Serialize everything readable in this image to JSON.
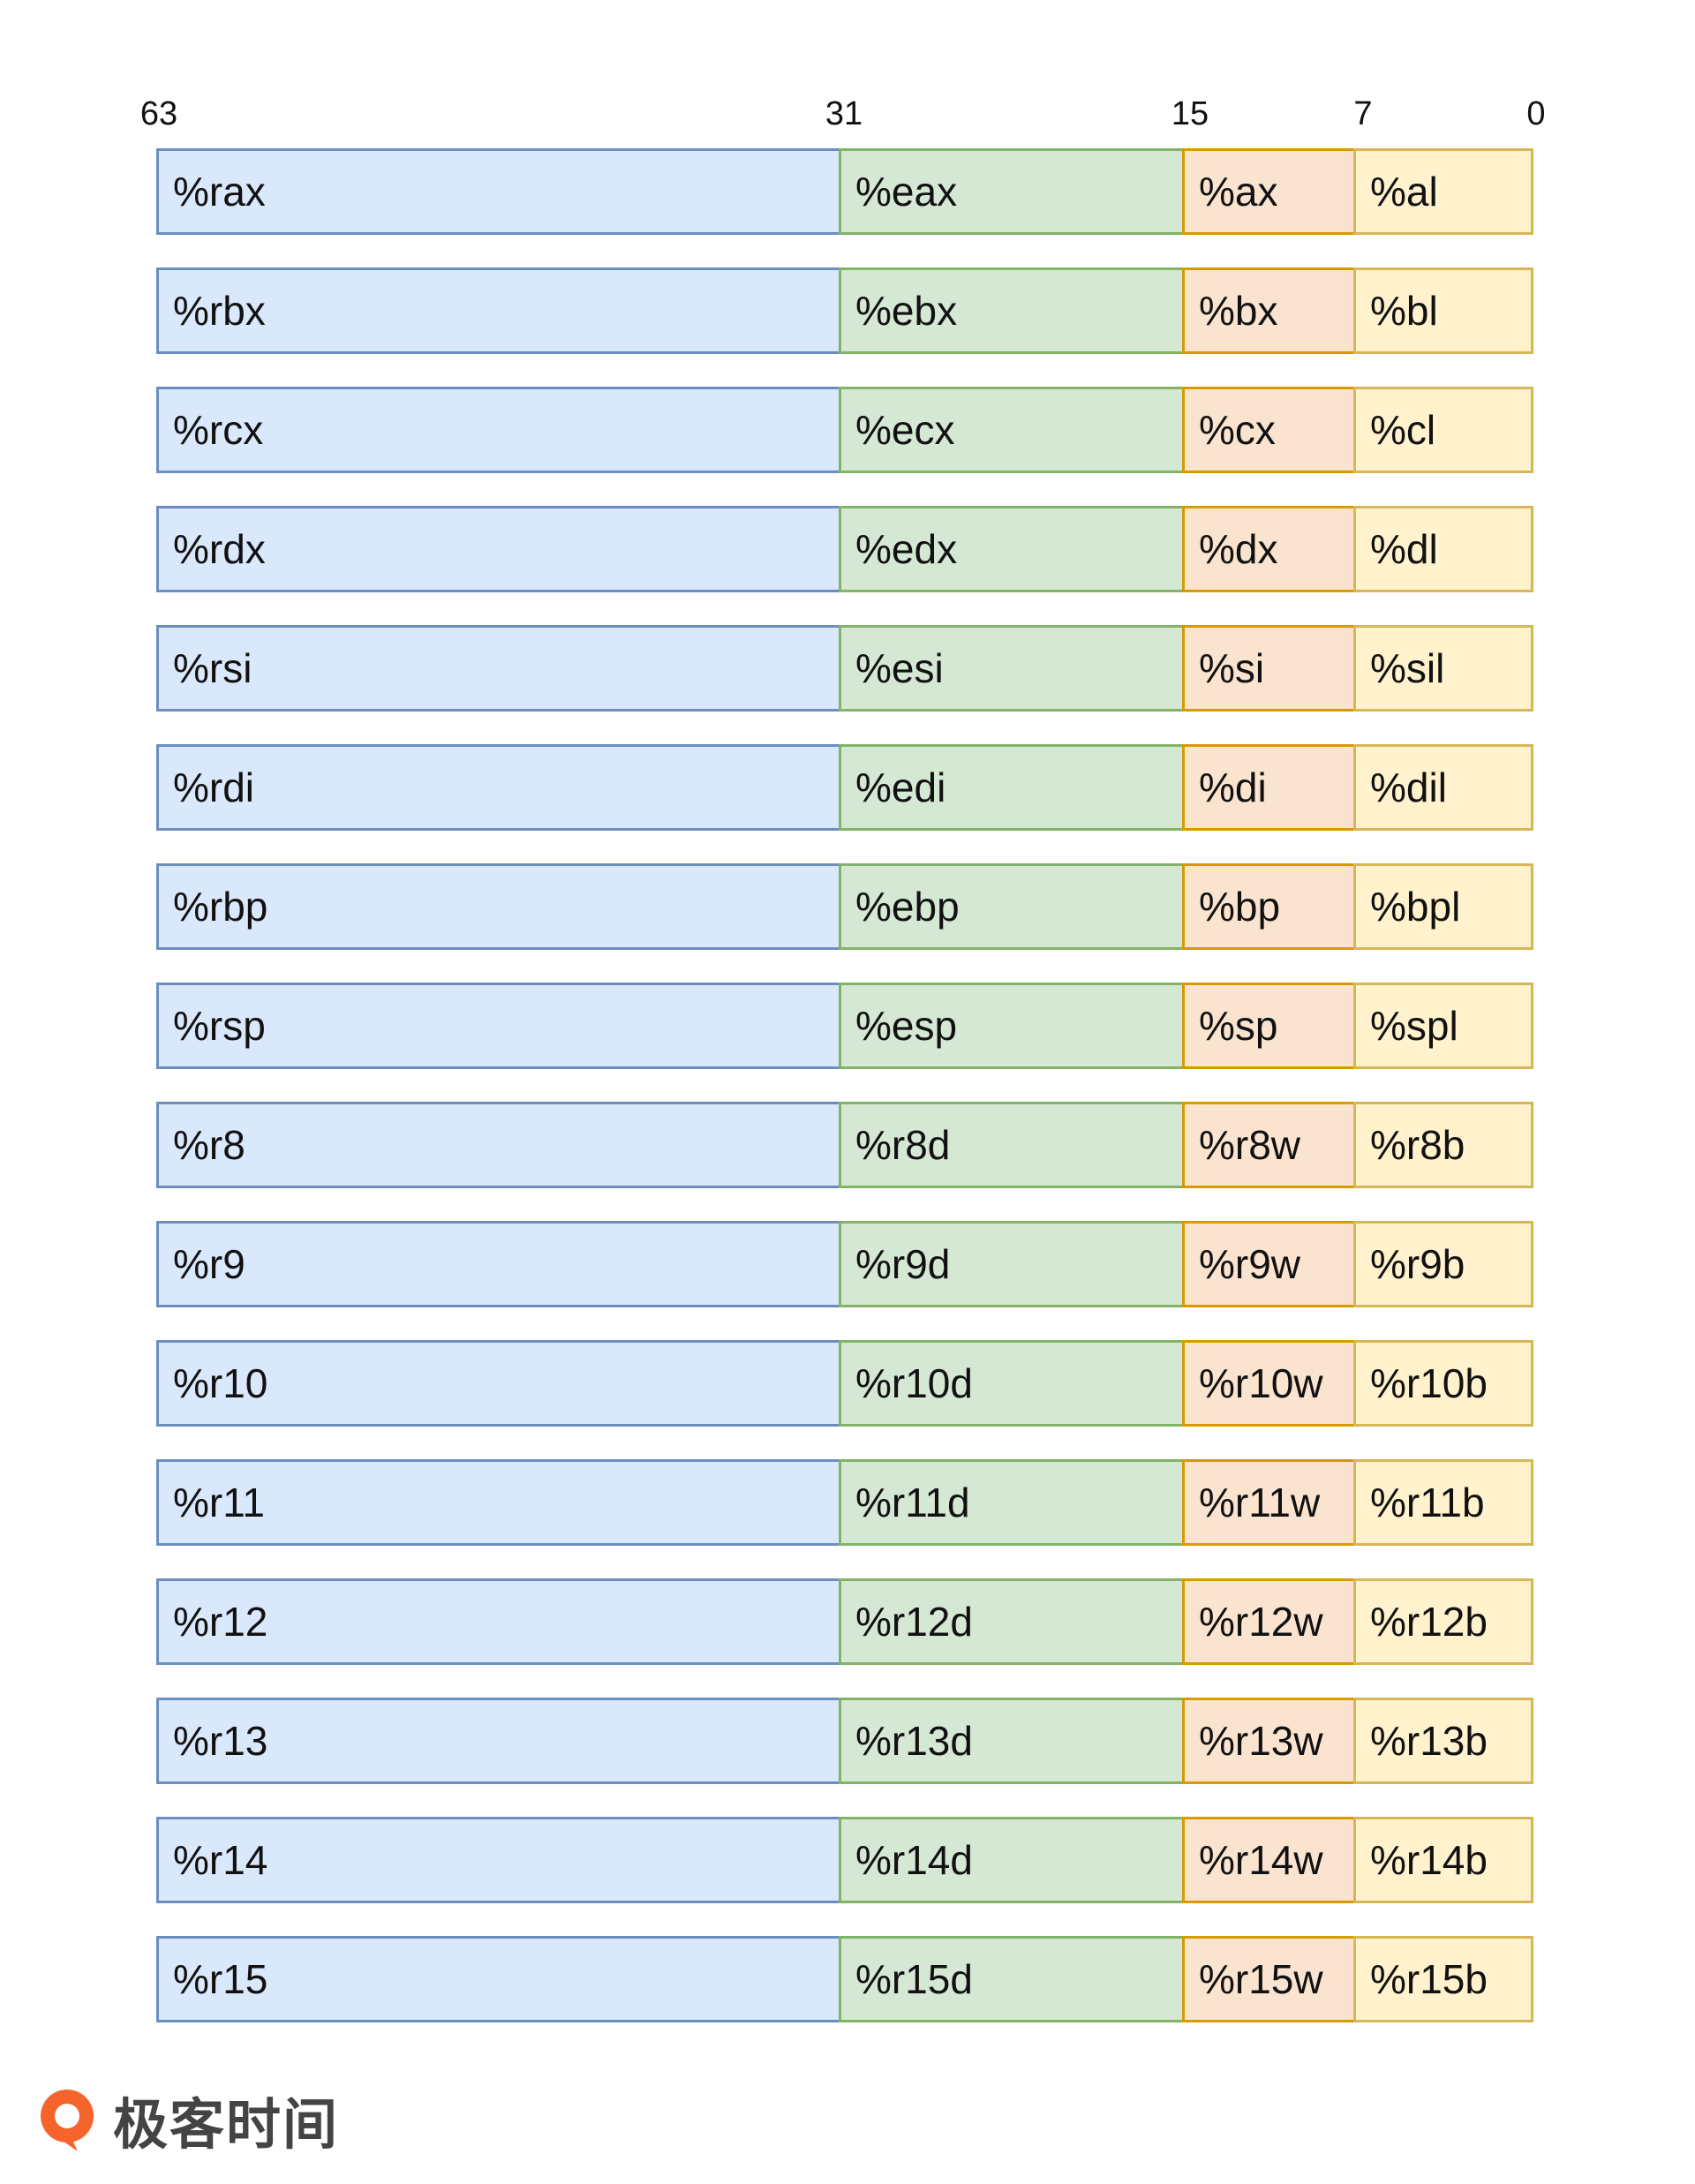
{
  "bit_labels": [
    "63",
    "31",
    "15",
    "7",
    "0"
  ],
  "colors": {
    "r64": "#dae8fc",
    "r32": "#d5e8d4",
    "r16": "#fae4cf",
    "r8": "#fff2cc"
  },
  "registers": [
    [
      "%rax",
      "%eax",
      "%ax",
      "%al"
    ],
    [
      "%rbx",
      "%ebx",
      "%bx",
      "%bl"
    ],
    [
      "%rcx",
      "%ecx",
      "%cx",
      "%cl"
    ],
    [
      "%rdx",
      "%edx",
      "%dx",
      "%dl"
    ],
    [
      "%rsi",
      "%esi",
      "%si",
      "%sil"
    ],
    [
      "%rdi",
      "%edi",
      "%di",
      "%dil"
    ],
    [
      "%rbp",
      "%ebp",
      "%bp",
      "%bpl"
    ],
    [
      "%rsp",
      "%esp",
      "%sp",
      "%spl"
    ],
    [
      "%r8",
      "%r8d",
      "%r8w",
      "%r8b"
    ],
    [
      "%r9",
      "%r9d",
      "%r9w",
      "%r9b"
    ],
    [
      "%r10",
      "%r10d",
      "%r10w",
      "%r10b"
    ],
    [
      "%r11",
      "%r11d",
      "%r11w",
      "%r11b"
    ],
    [
      "%r12",
      "%r12d",
      "%r12w",
      "%r12b"
    ],
    [
      "%r13",
      "%r13d",
      "%r13w",
      "%r13b"
    ],
    [
      "%r14",
      "%r14d",
      "%r14w",
      "%r14b"
    ],
    [
      "%r15",
      "%r15d",
      "%r15w",
      "%r15b"
    ]
  ],
  "logo": {
    "text": "极客时间",
    "icon": "geektime-logo-icon"
  }
}
